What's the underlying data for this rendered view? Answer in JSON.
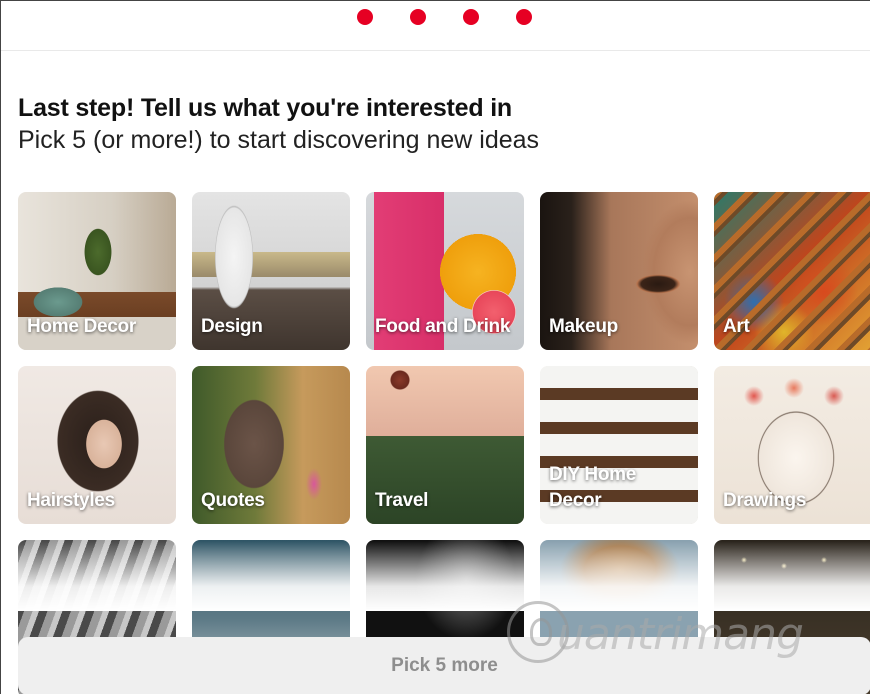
{
  "colors": {
    "accent": "#e60023",
    "button_bg": "#efefef",
    "button_text": "#8e8e8e"
  },
  "progress": {
    "steps": 4
  },
  "heading": {
    "title": "Last step! Tell us what you're interested in",
    "subtitle": "Pick 5 (or more!) to start discovering new ideas"
  },
  "topics": [
    {
      "label": "Home Decor"
    },
    {
      "label": "Design"
    },
    {
      "label": "Food and Drink"
    },
    {
      "label": "Makeup"
    },
    {
      "label": "Art"
    },
    {
      "label": "Hairstyles"
    },
    {
      "label": "Quotes"
    },
    {
      "label": "Travel"
    },
    {
      "label": "DIY Home Decor"
    },
    {
      "label": "Drawings"
    },
    {
      "label": ""
    },
    {
      "label": ""
    },
    {
      "label": ""
    },
    {
      "label": ""
    },
    {
      "label": ""
    }
  ],
  "footer": {
    "button_label": "Pick 5 more"
  },
  "watermark": {
    "text": "uantrimang"
  }
}
